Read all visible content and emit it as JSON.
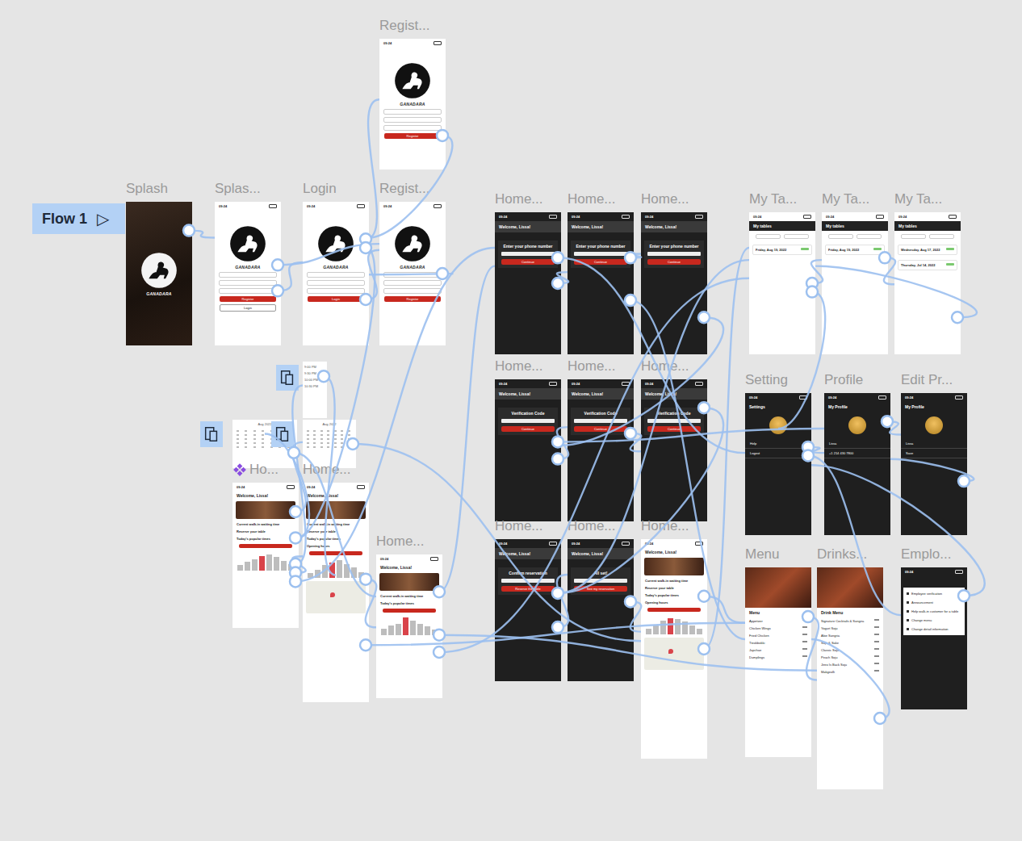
{
  "flow": {
    "label": "Flow 1",
    "play": "▷"
  },
  "time": "09:24",
  "frames": [
    {
      "label": "Splash",
      "kind": "splash",
      "component": false,
      "lines": [
        "GANADARA"
      ]
    },
    {
      "label": "Splas...",
      "kind": "auth",
      "component": false,
      "lines": [
        "GANADARA",
        "Register",
        "Login"
      ]
    },
    {
      "label": "Login",
      "kind": "auth",
      "component": false,
      "lines": [
        "GANADARA",
        "Login"
      ]
    },
    {
      "label": "Regist...",
      "kind": "auth",
      "component": false,
      "lines": [
        "GANADARA",
        "Register"
      ]
    },
    {
      "label": "Regist...",
      "kind": "auth",
      "component": false,
      "lines": [
        "GANADARA",
        "Register"
      ]
    },
    {
      "label": "",
      "kind": "picker",
      "component": false,
      "lines": [
        "9:00 PM",
        "9:30 PM",
        "10:00 PM",
        "10:30 PM"
      ]
    },
    {
      "label": "",
      "kind": "calendar",
      "component": false,
      "lines": [
        "Aug 2022"
      ]
    },
    {
      "label": "",
      "kind": "calendar",
      "component": false,
      "lines": [
        "Aug 2022"
      ]
    },
    {
      "label": "Ho...",
      "kind": "home-light",
      "component": true,
      "map": false,
      "lines": [
        "Welcome, Lissa!",
        "Current walk-in waiting time",
        "Reserve your table",
        "Today's popular times"
      ],
      "bars": [
        {
          "v": 30,
          "selected": false
        },
        {
          "v": 45,
          "selected": false
        },
        {
          "v": 60,
          "selected": false
        },
        {
          "v": 75,
          "selected": true
        },
        {
          "v": 85,
          "selected": false
        },
        {
          "v": 70,
          "selected": false
        },
        {
          "v": 50,
          "selected": false
        },
        {
          "v": 35,
          "selected": false
        }
      ]
    },
    {
      "label": "Home...",
      "kind": "home-light",
      "component": false,
      "map": true,
      "lines": [
        "Welcome, Lissa!",
        "Current walk-in waiting time",
        "Reserve your table",
        "Today's popular times",
        "Opening hours"
      ],
      "bars": [
        {
          "v": 25,
          "selected": false
        },
        {
          "v": 40,
          "selected": false
        },
        {
          "v": 65,
          "selected": false
        },
        {
          "v": 80,
          "selected": true
        },
        {
          "v": 90,
          "selected": false
        },
        {
          "v": 70,
          "selected": false
        },
        {
          "v": 55,
          "selected": false
        },
        {
          "v": 30,
          "selected": false
        }
      ]
    },
    {
      "label": "Home...",
      "kind": "home-light",
      "component": false,
      "map": false,
      "lines": [
        "Welcome, Lissa!",
        "Current walk-in waiting time",
        "Today's popular times"
      ],
      "bars": [
        {
          "v": 35,
          "selected": false
        },
        {
          "v": 50,
          "selected": false
        },
        {
          "v": 60,
          "selected": false
        },
        {
          "v": 90,
          "selected": true
        },
        {
          "v": 75,
          "selected": false
        },
        {
          "v": 60,
          "selected": false
        },
        {
          "v": 45,
          "selected": false
        },
        {
          "v": 30,
          "selected": false
        }
      ]
    },
    {
      "label": "Home...",
      "kind": "home-dark",
      "component": false,
      "lines": [
        "Welcome, Lissa!",
        "Enter your phone number",
        "Continue"
      ]
    },
    {
      "label": "Home...",
      "kind": "home-dark",
      "component": false,
      "lines": [
        "Welcome, Lissa!",
        "Enter your phone number",
        "Continue"
      ]
    },
    {
      "label": "Home...",
      "kind": "home-dark",
      "component": false,
      "lines": [
        "Welcome, Lissa!",
        "Enter your phone number",
        "Continue"
      ]
    },
    {
      "label": "Home...",
      "kind": "home-dark",
      "component": false,
      "lines": [
        "Welcome, Lissa!",
        "Verification Code",
        "Continue"
      ]
    },
    {
      "label": "Home...",
      "kind": "home-dark",
      "component": false,
      "lines": [
        "Welcome, Lissa!",
        "Verification Code",
        "Continue"
      ]
    },
    {
      "label": "Home...",
      "kind": "home-dark",
      "component": false,
      "lines": [
        "Welcome, Lissa!",
        "Verification Code",
        "Continue"
      ]
    },
    {
      "label": "Home...",
      "kind": "home-dark",
      "component": false,
      "lines": [
        "Welcome, Lissa!",
        "Confirm reservation",
        "Reserve the table"
      ]
    },
    {
      "label": "Home...",
      "kind": "home-dark",
      "component": false,
      "lines": [
        "Welcome, Lissa!",
        "All set!",
        "See my reservation"
      ]
    },
    {
      "label": "Home...",
      "kind": "home-light",
      "component": false,
      "map": true,
      "lines": [
        "Welcome, Lissa!",
        "Current walk-in waiting time",
        "Reserve your table",
        "Today's popular times",
        "Opening hours"
      ],
      "bars": [
        {
          "v": 30,
          "selected": false
        },
        {
          "v": 45,
          "selected": false
        },
        {
          "v": 70,
          "selected": false
        },
        {
          "v": 85,
          "selected": true
        },
        {
          "v": 80,
          "selected": false
        },
        {
          "v": 65,
          "selected": false
        },
        {
          "v": 45,
          "selected": false
        },
        {
          "v": 30,
          "selected": false
        }
      ]
    },
    {
      "label": "My Ta...",
      "kind": "tables",
      "component": false,
      "lines": [
        "My tables",
        "Friday, Aug 19, 2022"
      ]
    },
    {
      "label": "My Ta...",
      "kind": "tables",
      "component": false,
      "lines": [
        "My tables",
        "Friday, Aug 19, 2022"
      ]
    },
    {
      "label": "My Ta...",
      "kind": "tables",
      "component": false,
      "lines": [
        "My tables",
        "Wednesday, Aug 17, 2022",
        "Thursday, Jul 14, 2022"
      ]
    },
    {
      "label": "Setting",
      "kind": "profile",
      "component": false,
      "lines": [
        "Settings",
        "Help",
        "Logout"
      ]
    },
    {
      "label": "Profile",
      "kind": "profile",
      "component": false,
      "lines": [
        "My Profile",
        "Lissa",
        "+1 214 430 7800"
      ]
    },
    {
      "label": "Edit Pr...",
      "kind": "profile",
      "component": false,
      "lines": [
        "My Profile",
        "Lissa",
        "Save"
      ]
    },
    {
      "label": "Menu",
      "kind": "menu",
      "component": false,
      "lines": [
        "Menu",
        "Appetizer",
        "Chicken Wings",
        "Fried Chicken",
        "Tteokbokki",
        "Japchae",
        "Dumplings"
      ]
    },
    {
      "label": "Drinks...",
      "kind": "menu",
      "component": false,
      "lines": [
        "Drink Menu",
        "Signature Cocktails & Sangria",
        "Yogurt Soju",
        "Aloe Sangria",
        "Soju & Sake",
        "Classic Soju",
        "Peach Soju",
        "Jinro Is Back Soju",
        "Makgeolli"
      ]
    },
    {
      "label": "Emplo...",
      "kind": "employee",
      "component": false,
      "lines": [
        "Employee verification",
        "Announcement",
        "Help walk-in customer for a table",
        "Change menu",
        "Change detail information"
      ]
    }
  ],
  "links": [
    [
      0,
      1
    ],
    [
      1,
      2
    ],
    [
      1,
      4
    ],
    [
      2,
      3
    ],
    [
      2,
      4
    ],
    [
      4,
      2
    ],
    [
      2,
      8
    ],
    [
      3,
      2
    ],
    [
      8,
      5
    ],
    [
      8,
      6
    ],
    [
      8,
      7
    ],
    [
      8,
      9
    ],
    [
      9,
      10
    ],
    [
      10,
      11
    ],
    [
      8,
      11
    ],
    [
      11,
      12
    ],
    [
      12,
      13
    ],
    [
      13,
      14
    ],
    [
      14,
      15
    ],
    [
      15,
      16
    ],
    [
      16,
      17
    ],
    [
      17,
      18
    ],
    [
      18,
      19
    ],
    [
      19,
      26
    ],
    [
      10,
      20
    ],
    [
      20,
      21
    ],
    [
      21,
      22
    ],
    [
      22,
      20
    ],
    [
      20,
      23
    ],
    [
      23,
      24
    ],
    [
      24,
      25
    ],
    [
      25,
      24
    ],
    [
      23,
      28
    ],
    [
      26,
      27
    ],
    [
      27,
      26
    ],
    [
      19,
      20
    ],
    [
      11,
      23
    ],
    [
      9,
      26
    ],
    [
      10,
      27
    ],
    [
      17,
      20
    ],
    [
      28,
      23
    ],
    [
      12,
      26
    ],
    [
      14,
      24
    ],
    [
      5,
      9
    ],
    [
      6,
      10
    ],
    [
      7,
      19
    ]
  ]
}
